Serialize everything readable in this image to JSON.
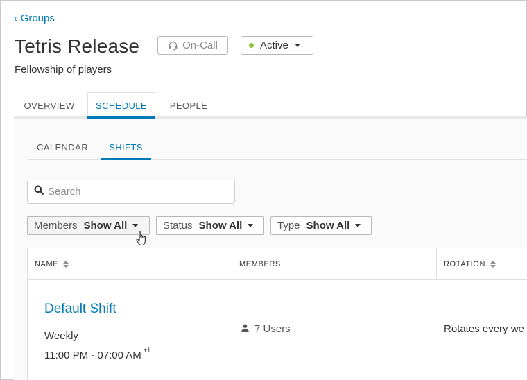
{
  "breadcrumb": {
    "label": "Groups"
  },
  "group": {
    "title": "Tetris Release",
    "subtitle": "Fellowship of players",
    "oncall_label": "On-Call",
    "status_label": "Active",
    "status_color": "#8cc63f"
  },
  "tabs": [
    {
      "label": "OVERVIEW"
    },
    {
      "label": "SCHEDULE",
      "active": true
    },
    {
      "label": "PEOPLE"
    }
  ],
  "subtabs": [
    {
      "label": "CALENDAR"
    },
    {
      "label": "SHIFTS",
      "active": true
    }
  ],
  "search": {
    "placeholder": "Search",
    "value": ""
  },
  "filters": {
    "members": {
      "label": "Members",
      "value": "Show All"
    },
    "status": {
      "label": "Status",
      "value": "Show All"
    },
    "type": {
      "label": "Type",
      "value": "Show All"
    }
  },
  "table": {
    "columns": {
      "name": "NAME",
      "members": "MEMBERS",
      "rotation": "ROTATION"
    },
    "rows": [
      {
        "name": "Default Shift",
        "frequency": "Weekly",
        "time": "11:00 PM - 07:00 AM",
        "time_suffix": "+1",
        "members": "7 Users",
        "rotation": "Rotates every we"
      }
    ]
  },
  "colors": {
    "accent": "#0079b8",
    "active_dot": "#8cc63f"
  }
}
